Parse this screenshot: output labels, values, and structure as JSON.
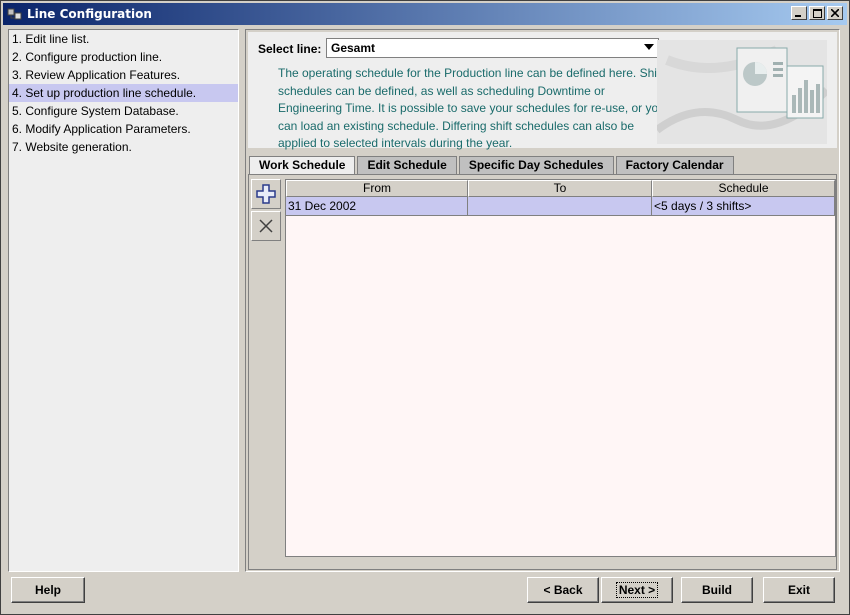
{
  "window": {
    "title": "Line Configuration",
    "minimize": "_",
    "maximize": "□",
    "close": "✕"
  },
  "sidebar": {
    "items": [
      {
        "label": "1. Edit line list."
      },
      {
        "label": "2. Configure production line."
      },
      {
        "label": "3. Review Application Features."
      },
      {
        "label": "4. Set up production line schedule."
      },
      {
        "label": "5. Configure System Database."
      },
      {
        "label": "6. Modify Application Parameters."
      },
      {
        "label": "7. Website generation."
      }
    ],
    "selected_index": 3
  },
  "header": {
    "select_label": "Select line:",
    "select_value": "Gesamt",
    "description": "The operating schedule for the Production line can be defined here. Shift schedules can be defined, as well as scheduling Downtime or Engineering Time. It is possible to save your schedules for re-use, or you can load an existing schedule. Differing shift schedules can also be applied to selected intervals during the year."
  },
  "tabs": [
    {
      "label": "Work Schedule",
      "active": true
    },
    {
      "label": "Edit Schedule",
      "active": false
    },
    {
      "label": "Specific Day Schedules",
      "active": false
    },
    {
      "label": "Factory Calendar",
      "active": false
    }
  ],
  "table": {
    "columns": [
      "From",
      "To",
      "Schedule"
    ],
    "rows": [
      {
        "from": "31 Dec 2002",
        "to": "",
        "schedule": "<5 days / 3 shifts>"
      }
    ]
  },
  "toolbar": {
    "add_icon": "plus-icon",
    "remove_icon": "delete-icon"
  },
  "buttons": {
    "help": "Help",
    "back": "< Back",
    "next": "Next >",
    "build": "Build",
    "exit": "Exit"
  },
  "colors": {
    "title_bar": "#0a246a",
    "selected": "#c8c8f0",
    "description_text": "#1a6b6b"
  }
}
